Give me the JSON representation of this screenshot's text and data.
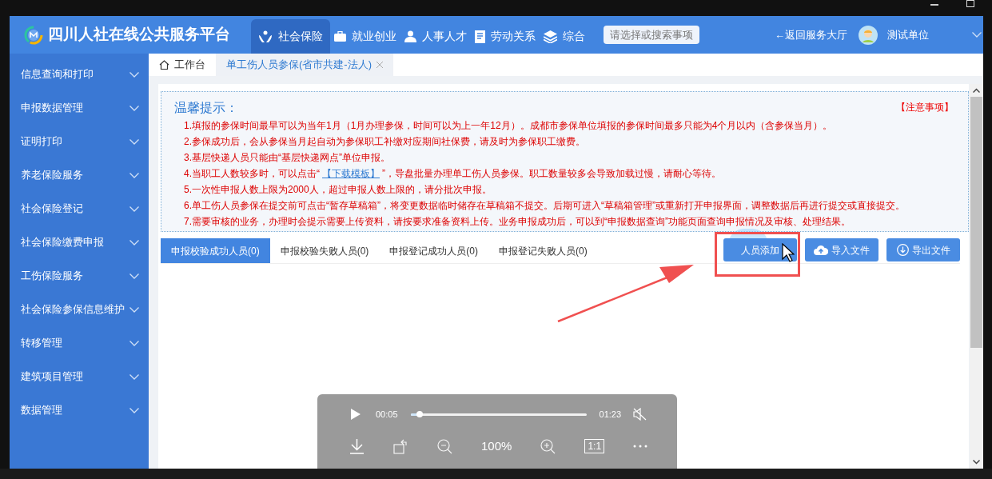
{
  "header": {
    "title": "四川人社在线公共服务平台",
    "nav": [
      {
        "label": "社会保险",
        "selected": true
      },
      {
        "label": "就业创业",
        "selected": false
      },
      {
        "label": "人事人才",
        "selected": false
      },
      {
        "label": "劳动关系",
        "selected": false
      },
      {
        "label": "综合",
        "selected": false
      }
    ],
    "search": {
      "placeholder": "请选择或搜索事项"
    },
    "back_link": "←返回服务大厅",
    "user": "测试单位"
  },
  "sidebar": {
    "items": [
      {
        "label": "信息查询和打印"
      },
      {
        "label": "申报数据管理"
      },
      {
        "label": "证明打印"
      },
      {
        "label": "养老保险服务"
      },
      {
        "label": "社会保险登记"
      },
      {
        "label": "社会保险缴费申报"
      },
      {
        "label": "工伤保险服务"
      },
      {
        "label": "社会保险参保信息维护"
      },
      {
        "label": "转移管理"
      },
      {
        "label": "建筑项目管理"
      },
      {
        "label": "数据管理"
      }
    ]
  },
  "page_tabs": [
    {
      "label": "工作台",
      "kind": "home",
      "selected": false
    },
    {
      "label": "单工伤人员参保(省市共建-法人)",
      "kind": "closable",
      "selected": true
    }
  ],
  "notice": {
    "title": "温馨提示：",
    "link": "【注意事项】",
    "lines": [
      "1.填报的参保时间最早可以为当年1月（1月办理参保，时间可以为上一年12月）。成都市参保单位填报的参保时间最多只能为4个月以内（含参保当月）。",
      "2.参保成功后，会从参保当月起自动为参保职工补缴对应期间社保费，请及时为参保职工缴费。",
      "3.基层快递人员只能由“基层快递网点”单位申报。",
      [
        {
          "kind": "text",
          "text": "4.当职工人数较多时，可以点击“"
        },
        {
          "kind": "link",
          "text": "【下载模板】"
        },
        {
          "kind": "text",
          "text": "”，导盘批量办理单工伤人员参保。职工数量较多会导致加载过慢，请耐心等待。"
        }
      ],
      "5.一次性申报人数上限为2000人，超过申报人数上限的，请分批次申报。",
      "6.单工伤人员参保在提交前可点击“暂存草稿箱”，将变更数据临时储存在草稿箱不提交。后期可进入“草稿箱管理”或重新打开申报界面，调整数据后再进行提交或直接提交。",
      "7.需要审核的业务，办理时会提示需要上传资料，请按要求准备资料上传。业务申报成功后，可以到“申报数据查询”功能页面查询申报情况及审核、处理结果。"
    ]
  },
  "result_tabs": [
    {
      "label": "申报校验成功人员(0)",
      "selected": true
    },
    {
      "label": "申报校验失败人员(0)",
      "selected": false
    },
    {
      "label": "申报登记成功人员(0)",
      "selected": false
    },
    {
      "label": "申报登记失败人员(0)",
      "selected": false
    }
  ],
  "actions": [
    {
      "label": "人员添加"
    },
    {
      "label": "导入文件"
    },
    {
      "label": "导出文件"
    }
  ],
  "player": {
    "elapsed": "00:05",
    "duration": "01:23",
    "level": 0.05,
    "muted": true,
    "zoom": "100%",
    "ratio": "1:1"
  }
}
